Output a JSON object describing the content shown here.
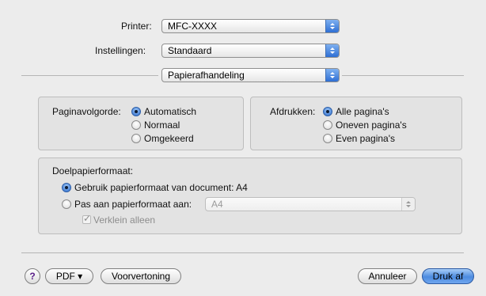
{
  "printer": {
    "label": "Printer:",
    "value": "MFC-XXXX"
  },
  "presets": {
    "label": "Instellingen:",
    "value": "Standaard"
  },
  "section": {
    "value": "Papierafhandeling"
  },
  "page_order": {
    "label": "Paginavolgorde:",
    "options": [
      "Automatisch",
      "Normaal",
      "Omgekeerd"
    ],
    "selected": "Automatisch"
  },
  "print_pages": {
    "label": "Afdrukken:",
    "options": [
      "Alle pagina's",
      "Oneven pagina's",
      "Even pagina's"
    ],
    "selected": "Alle pagina's"
  },
  "destination": {
    "label": "Doelpapierformaat:",
    "use_document": "Gebruik papierformaat van document: A4",
    "scale_to": "Pas aan papierformaat aan:",
    "scale_value": "A4",
    "shrink_only": "Verklein alleen"
  },
  "footer": {
    "help": "?",
    "pdf": "PDF ▾",
    "preview": "Voorvertoning",
    "cancel": "Annuleer",
    "print": "Druk af"
  }
}
